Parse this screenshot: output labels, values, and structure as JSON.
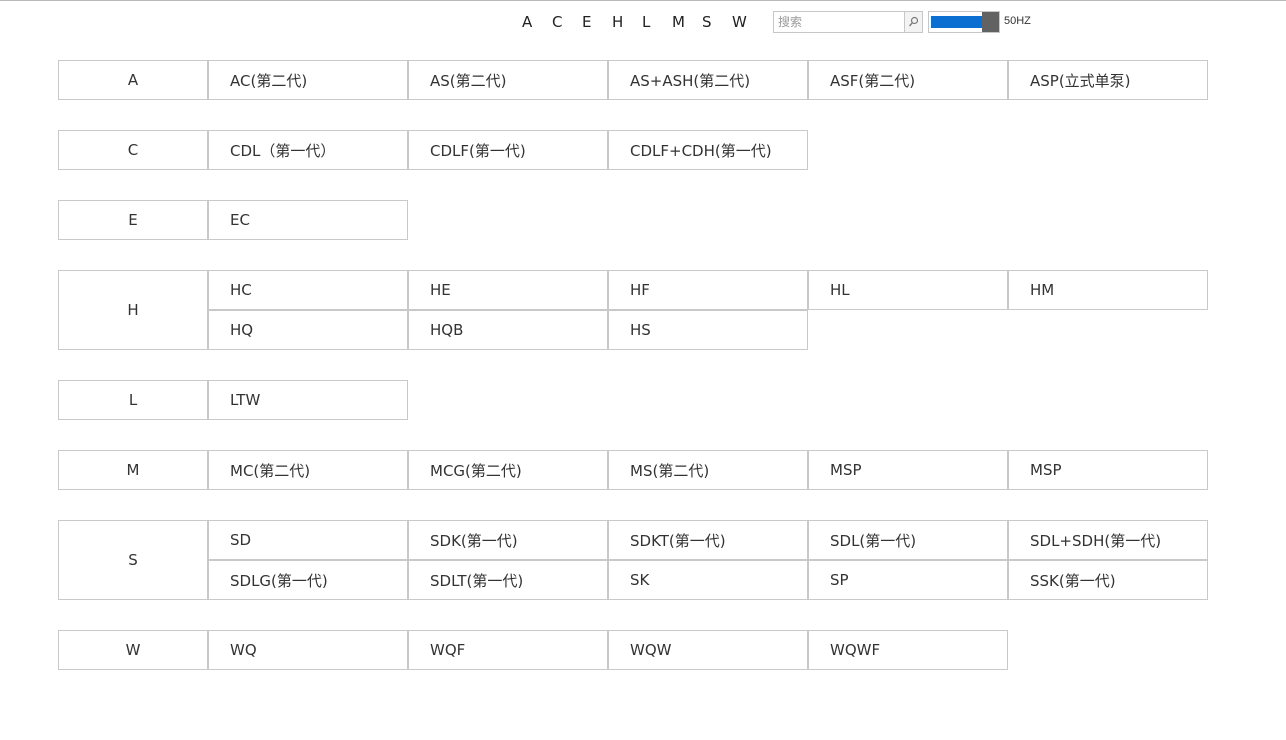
{
  "letter_nav": [
    "A",
    "C",
    "E",
    "H",
    "L",
    "M",
    "S",
    "W"
  ],
  "search": {
    "placeholder": "搜索",
    "value": "",
    "icon": "magnifier-icon"
  },
  "frequency": {
    "label": "50HZ",
    "fill_fraction": 0.8
  },
  "colors": {
    "toggle_fill": "#0a6fd0",
    "toggle_knob": "#626262",
    "border": "#c9c9c9"
  },
  "groups": [
    {
      "letter": "A",
      "items": [
        "AC(第二代)",
        "AS(第二代)",
        "AS+ASH(第二代)",
        "ASF(第二代)",
        "ASP(立式单泵)"
      ]
    },
    {
      "letter": "C",
      "items": [
        "CDL（第一代）",
        "CDLF(第一代)",
        "CDLF+CDH(第一代)"
      ]
    },
    {
      "letter": "E",
      "items": [
        "EC"
      ]
    },
    {
      "letter": "H",
      "items": [
        "HC",
        "HE",
        "HF",
        "HL",
        "HM",
        "HQ",
        "HQB",
        "HS"
      ]
    },
    {
      "letter": "L",
      "items": [
        "LTW"
      ]
    },
    {
      "letter": "M",
      "items": [
        "MC(第二代)",
        "MCG(第二代)",
        "MS(第二代)",
        "MSP",
        "MSP"
      ]
    },
    {
      "letter": "S",
      "items": [
        "SD",
        "SDK(第一代)",
        "SDKT(第一代)",
        "SDL(第一代)",
        "SDL+SDH(第一代)",
        "SDLG(第一代)",
        "SDLT(第一代)",
        "SK",
        "SP",
        "SSK(第一代)"
      ]
    },
    {
      "letter": "W",
      "items": [
        "WQ",
        "WQF",
        "WQW",
        "WQWF"
      ]
    }
  ]
}
